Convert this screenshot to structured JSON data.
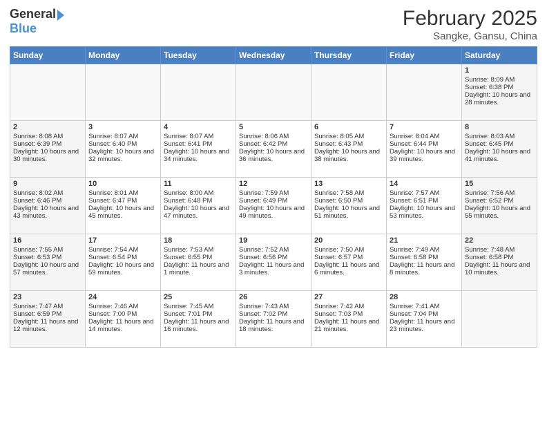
{
  "header": {
    "logo_general": "General",
    "logo_blue": "Blue",
    "main_title": "February 2025",
    "subtitle": "Sangke, Gansu, China"
  },
  "weekdays": [
    "Sunday",
    "Monday",
    "Tuesday",
    "Wednesday",
    "Thursday",
    "Friday",
    "Saturday"
  ],
  "weeks": [
    [
      {
        "day": "",
        "info": ""
      },
      {
        "day": "",
        "info": ""
      },
      {
        "day": "",
        "info": ""
      },
      {
        "day": "",
        "info": ""
      },
      {
        "day": "",
        "info": ""
      },
      {
        "day": "",
        "info": ""
      },
      {
        "day": "1",
        "info": "Sunrise: 8:09 AM\nSunset: 6:38 PM\nDaylight: 10 hours and 28 minutes."
      }
    ],
    [
      {
        "day": "2",
        "info": "Sunrise: 8:08 AM\nSunset: 6:39 PM\nDaylight: 10 hours and 30 minutes."
      },
      {
        "day": "3",
        "info": "Sunrise: 8:07 AM\nSunset: 6:40 PM\nDaylight: 10 hours and 32 minutes."
      },
      {
        "day": "4",
        "info": "Sunrise: 8:07 AM\nSunset: 6:41 PM\nDaylight: 10 hours and 34 minutes."
      },
      {
        "day": "5",
        "info": "Sunrise: 8:06 AM\nSunset: 6:42 PM\nDaylight: 10 hours and 36 minutes."
      },
      {
        "day": "6",
        "info": "Sunrise: 8:05 AM\nSunset: 6:43 PM\nDaylight: 10 hours and 38 minutes."
      },
      {
        "day": "7",
        "info": "Sunrise: 8:04 AM\nSunset: 6:44 PM\nDaylight: 10 hours and 39 minutes."
      },
      {
        "day": "8",
        "info": "Sunrise: 8:03 AM\nSunset: 6:45 PM\nDaylight: 10 hours and 41 minutes."
      }
    ],
    [
      {
        "day": "9",
        "info": "Sunrise: 8:02 AM\nSunset: 6:46 PM\nDaylight: 10 hours and 43 minutes."
      },
      {
        "day": "10",
        "info": "Sunrise: 8:01 AM\nSunset: 6:47 PM\nDaylight: 10 hours and 45 minutes."
      },
      {
        "day": "11",
        "info": "Sunrise: 8:00 AM\nSunset: 6:48 PM\nDaylight: 10 hours and 47 minutes."
      },
      {
        "day": "12",
        "info": "Sunrise: 7:59 AM\nSunset: 6:49 PM\nDaylight: 10 hours and 49 minutes."
      },
      {
        "day": "13",
        "info": "Sunrise: 7:58 AM\nSunset: 6:50 PM\nDaylight: 10 hours and 51 minutes."
      },
      {
        "day": "14",
        "info": "Sunrise: 7:57 AM\nSunset: 6:51 PM\nDaylight: 10 hours and 53 minutes."
      },
      {
        "day": "15",
        "info": "Sunrise: 7:56 AM\nSunset: 6:52 PM\nDaylight: 10 hours and 55 minutes."
      }
    ],
    [
      {
        "day": "16",
        "info": "Sunrise: 7:55 AM\nSunset: 6:53 PM\nDaylight: 10 hours and 57 minutes."
      },
      {
        "day": "17",
        "info": "Sunrise: 7:54 AM\nSunset: 6:54 PM\nDaylight: 10 hours and 59 minutes."
      },
      {
        "day": "18",
        "info": "Sunrise: 7:53 AM\nSunset: 6:55 PM\nDaylight: 11 hours and 1 minute."
      },
      {
        "day": "19",
        "info": "Sunrise: 7:52 AM\nSunset: 6:56 PM\nDaylight: 11 hours and 3 minutes."
      },
      {
        "day": "20",
        "info": "Sunrise: 7:50 AM\nSunset: 6:57 PM\nDaylight: 11 hours and 6 minutes."
      },
      {
        "day": "21",
        "info": "Sunrise: 7:49 AM\nSunset: 6:58 PM\nDaylight: 11 hours and 8 minutes."
      },
      {
        "day": "22",
        "info": "Sunrise: 7:48 AM\nSunset: 6:58 PM\nDaylight: 11 hours and 10 minutes."
      }
    ],
    [
      {
        "day": "23",
        "info": "Sunrise: 7:47 AM\nSunset: 6:59 PM\nDaylight: 11 hours and 12 minutes."
      },
      {
        "day": "24",
        "info": "Sunrise: 7:46 AM\nSunset: 7:00 PM\nDaylight: 11 hours and 14 minutes."
      },
      {
        "day": "25",
        "info": "Sunrise: 7:45 AM\nSunset: 7:01 PM\nDaylight: 11 hours and 16 minutes."
      },
      {
        "day": "26",
        "info": "Sunrise: 7:43 AM\nSunset: 7:02 PM\nDaylight: 11 hours and 18 minutes."
      },
      {
        "day": "27",
        "info": "Sunrise: 7:42 AM\nSunset: 7:03 PM\nDaylight: 11 hours and 21 minutes."
      },
      {
        "day": "28",
        "info": "Sunrise: 7:41 AM\nSunset: 7:04 PM\nDaylight: 11 hours and 23 minutes."
      },
      {
        "day": "",
        "info": ""
      }
    ]
  ]
}
